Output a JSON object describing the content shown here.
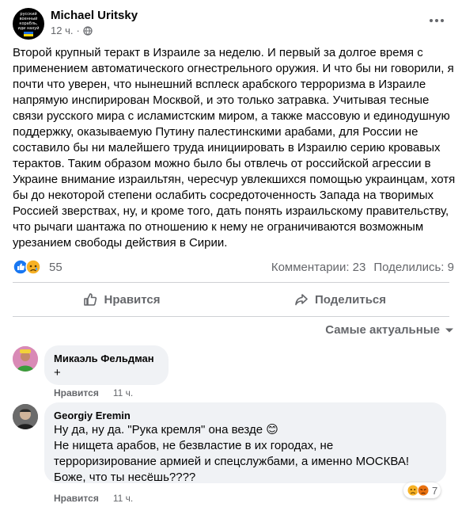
{
  "post": {
    "author": "Michael Uritsky",
    "time": "12 ч.",
    "avatar_text": "русский военный корабль, иди нахуй",
    "text": "Второй крупный теракт в Израиле за неделю. И первый за долгое время с применением автоматического огнестрельного оружия. И что бы ни говорили, я почти что уверен, что нынешний всплеск арабского терроризма в Израиле напрямую инспирирован Москвой, и это только затравка. Учитывая тесные связи русского мира с исламистским миром, а также массовую и единодушную поддержку, оказываемую Путину палестинскими арабами, для России не составило бы ни малейшего труда инициировать в Израилю серию кровавых терактов. Таким образом можно было бы отвлечь от российской агрессии в Украине внимание израильтян, чересчур увлекшихся помощью украинцам, хотя бы до некоторой степени ослабить сосредоточенность Запада на творимых Россией зверствах, ну, и кроме того, дать понять израильскому правительству, что рычаги шантажа по отношению к нему не ограничиваются возможным урезанием свободы действия в Сирии.",
    "reactions_count": "55",
    "comments_label": "Комментарии: 23",
    "shares_label": "Поделились: 9"
  },
  "actions": {
    "like_label": "Нравится",
    "share_label": "Поделиться"
  },
  "sort_label": "Самые актуальные",
  "comments": [
    {
      "name": "Микаэль Фельдман",
      "text": "+",
      "like_label": "Нравится",
      "time": "11 ч."
    },
    {
      "name": "Georgiy Eremin",
      "text_lines": [
        "Ну да, ну да. \"Рука кремля\" она везде 😊",
        "Не нищета арабов, не безвластие в их городах, не",
        "терроризирование армией и спецслужбами, а именно МОСКВА!",
        "Боже, что ты несёшь????"
      ],
      "reactions_count": "7",
      "like_label": "Нравится",
      "time": "11 ч."
    }
  ],
  "colors": {
    "secondary_text": "#65676b",
    "bubble_bg": "#f0f2f5",
    "like_blue": "#1877f2",
    "sad_yellow": "#f7b125",
    "angry_orange": "#e9710f"
  }
}
